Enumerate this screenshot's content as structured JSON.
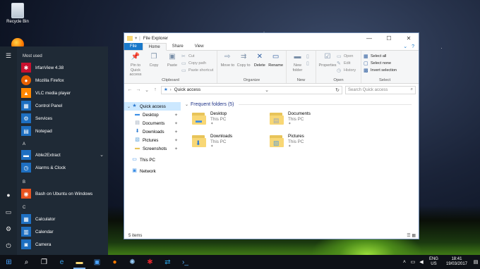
{
  "desktop": {
    "recycle_bin_label": "Recycle Bin"
  },
  "start_menu": {
    "most_used_header": "Most used",
    "most_used": [
      {
        "label": "IrfanView 4.38",
        "icon": "irfanview-icon",
        "color": "#c8102e"
      },
      {
        "label": "Mozilla Firefox",
        "icon": "firefox-icon",
        "color": "#e66000"
      },
      {
        "label": "VLC media player",
        "icon": "vlc-icon",
        "color": "#ff8800"
      },
      {
        "label": "Control Panel",
        "icon": "control-panel-icon",
        "color": "#1e6fc1"
      },
      {
        "label": "Services",
        "icon": "services-icon",
        "color": "#1e6fc1"
      },
      {
        "label": "Notepad",
        "icon": "notepad-icon",
        "color": "#1e6fc1"
      }
    ],
    "section_a": "A",
    "a_apps": [
      {
        "label": "Able2Extract",
        "icon": "folder-icon",
        "color": "#1e6fc1",
        "expandable": true
      },
      {
        "label": "Alarms & Clock",
        "icon": "alarm-icon",
        "color": "#1e6fc1"
      }
    ],
    "section_b": "B",
    "b_apps": [
      {
        "label": "Bash on Ubuntu on Windows",
        "icon": "ubuntu-icon",
        "color": "#e95420"
      }
    ],
    "section_c": "C",
    "c_apps": [
      {
        "label": "Calculator",
        "icon": "calculator-icon",
        "color": "#1e6fc1"
      },
      {
        "label": "Calendar",
        "icon": "calendar-icon",
        "color": "#1e6fc1"
      },
      {
        "label": "Camera",
        "icon": "camera-icon",
        "color": "#1e6fc1"
      }
    ]
  },
  "explorer": {
    "title": "File Explorer",
    "tabs": {
      "file": "File",
      "home": "Home",
      "share": "Share",
      "view": "View"
    },
    "ribbon": {
      "clipboard": {
        "label": "Clipboard",
        "pin": "Pin to Quick access",
        "copy": "Copy",
        "paste": "Paste",
        "cut": "Cut",
        "copy_path": "Copy path",
        "paste_shortcut": "Paste shortcut"
      },
      "organize": {
        "label": "Organize",
        "move_to": "Move to",
        "copy_to": "Copy to",
        "delete": "Delete",
        "rename": "Rename"
      },
      "new": {
        "label": "New",
        "new_folder": "New folder"
      },
      "open": {
        "label": "Open",
        "properties": "Properties",
        "open": "Open",
        "edit": "Edit",
        "history": "History"
      },
      "select": {
        "label": "Select",
        "select_all": "Select all",
        "select_none": "Select none",
        "invert": "Invert selection"
      }
    },
    "address": {
      "path": "Quick access",
      "search_placeholder": "Search Quick access"
    },
    "nav": {
      "quick_access": "Quick access",
      "pinned": [
        "Desktop",
        "Documents",
        "Downloads",
        "Pictures",
        "Screenshots"
      ],
      "this_pc": "This PC",
      "network": "Network"
    },
    "frequent_header": "Frequent folders (5)",
    "folders": [
      {
        "name": "Desktop",
        "location": "This PC"
      },
      {
        "name": "Documents",
        "location": "This PC"
      },
      {
        "name": "Downloads",
        "location": "This PC"
      },
      {
        "name": "Pictures",
        "location": "This PC"
      }
    ],
    "status": "5 items"
  },
  "taskbar": {
    "lang_top": "ENG",
    "lang_bottom": "US",
    "time": "18:41",
    "date": "19/03/2017"
  }
}
